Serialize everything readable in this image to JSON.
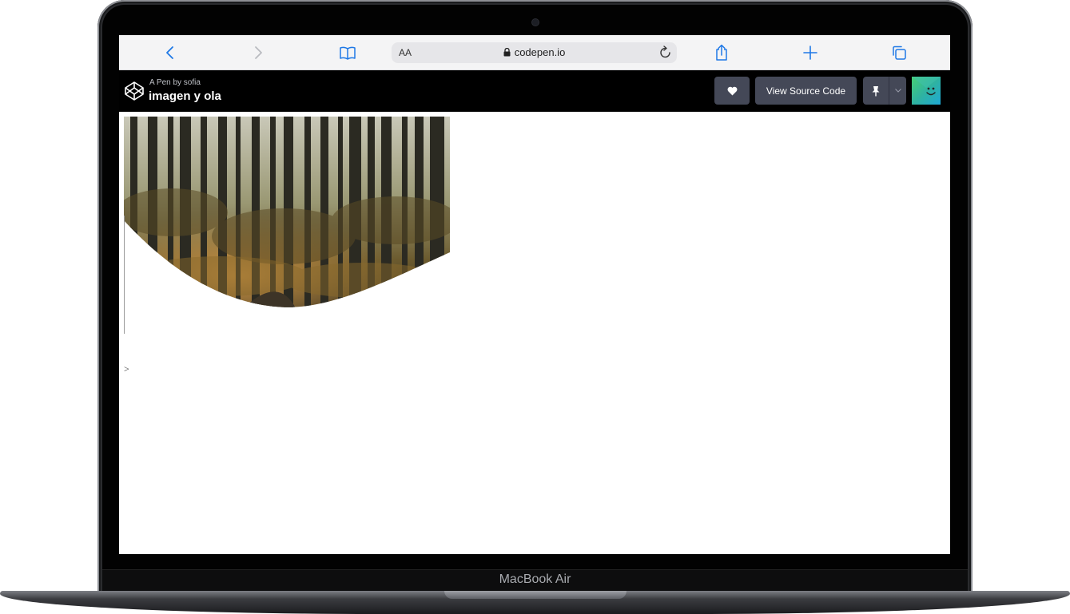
{
  "browser": {
    "url": "codepen.io",
    "text_size_label": "AA"
  },
  "codepen": {
    "pen_by": "A Pen by sofia",
    "pen_title": "imagen y ola",
    "source_button": "View Source Code"
  },
  "page": {
    "stray_text": ">"
  },
  "device": {
    "model_label": "MacBook Air"
  },
  "colors": {
    "safari_blue": "#1e78e6",
    "codepen_header": "#000000",
    "button_bg": "#444857"
  }
}
